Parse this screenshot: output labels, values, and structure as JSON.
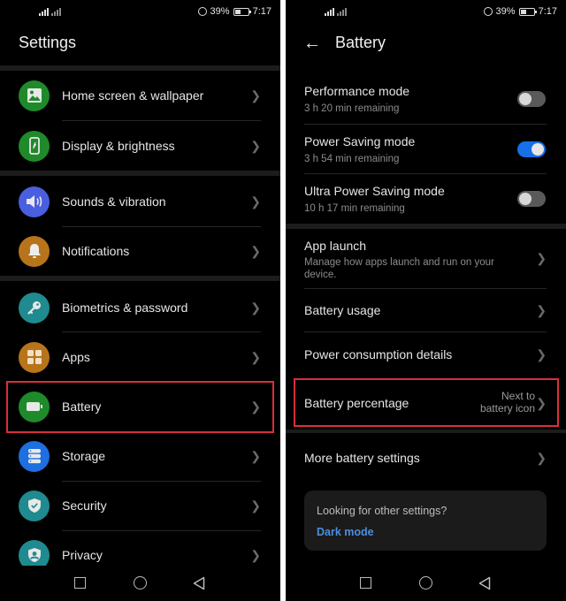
{
  "status_bar": {
    "battery_percent": "39%",
    "time": "7:17",
    "alarm_icon": "alarm-icon",
    "signal_icon": "signal-icon",
    "battery_icon": "battery-status-icon"
  },
  "left_screen": {
    "title": "Settings",
    "items": [
      {
        "label": "Home screen & wallpaper",
        "icon": "wallpaper-icon",
        "color": "#1f8a2a"
      },
      {
        "label": "Display & brightness",
        "icon": "display-icon",
        "color": "#1f8a2a"
      },
      {
        "label": "Sounds & vibration",
        "icon": "sound-icon",
        "color": "#4a5ee0"
      },
      {
        "label": "Notifications",
        "icon": "bell-icon",
        "color": "#b8741a"
      },
      {
        "label": "Biometrics & password",
        "icon": "key-icon",
        "color": "#1f8a8f"
      },
      {
        "label": "Apps",
        "icon": "apps-grid-icon",
        "color": "#b8741a"
      },
      {
        "label": "Battery",
        "icon": "battery-icon",
        "color": "#1f8a2a"
      },
      {
        "label": "Storage",
        "icon": "storage-icon",
        "color": "#1e6fe0"
      },
      {
        "label": "Security",
        "icon": "shield-check-icon",
        "color": "#1f8a8f"
      },
      {
        "label": "Privacy",
        "icon": "privacy-icon",
        "color": "#1f8a8f"
      }
    ],
    "highlighted_item": "Battery"
  },
  "right_screen": {
    "title": "Battery",
    "modes": [
      {
        "title": "Performance mode",
        "subtitle": "3 h 20 min remaining",
        "enabled": false
      },
      {
        "title": "Power Saving mode",
        "subtitle": "3 h 54 min remaining",
        "enabled": true
      },
      {
        "title": "Ultra Power Saving mode",
        "subtitle": "10 h 17 min remaining",
        "enabled": false
      }
    ],
    "items": [
      {
        "title": "App launch",
        "subtitle": "Manage how apps launch and run on your device."
      },
      {
        "title": "Battery usage"
      },
      {
        "title": "Power consumption details"
      },
      {
        "title": "Battery percentage",
        "value_line1": "Next to",
        "value_line2": "battery icon"
      },
      {
        "title": "More battery settings"
      }
    ],
    "highlighted_item": "Battery percentage",
    "suggestion": {
      "question": "Looking for other settings?",
      "link": "Dark mode"
    },
    "accent_color": "#1670e8"
  },
  "nav": {
    "recent": "recent-apps-icon",
    "home": "home-icon",
    "back": "back-icon"
  },
  "highlight_color": "#d8303a"
}
